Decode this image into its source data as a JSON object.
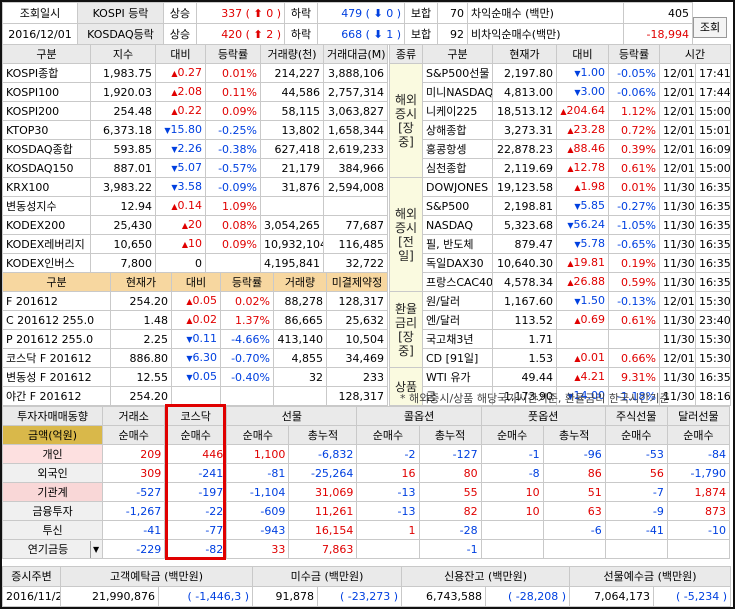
{
  "topbar": {
    "date_label": "조회일시",
    "date_value": "2016/12/01",
    "kospi_label": "KOSPI 등락",
    "kosdaq_label": "KOSDAQ등락",
    "up_label": "상승",
    "down_label": "하락",
    "flat_label": "보합",
    "kospi_up": "337",
    "kospi_uplimit": "0",
    "kospi_down": "479",
    "kospi_downlimit": "0",
    "kospi_flat": "70",
    "kosdaq_up": "420",
    "kosdaq_uplimit": "2",
    "kosdaq_down": "668",
    "kosdaq_downlimit": "1",
    "kosdaq_flat": "92",
    "arb_label": "차익순매수 (백만)",
    "arb_value": "405",
    "nonarb_label": "비차익순매수(백만)",
    "nonarb_value": "-18,994",
    "search_button": "조회"
  },
  "domestic": {
    "headers": [
      "구분",
      "지수",
      "대비",
      "등락률",
      "거래량(천)",
      "거래대금(M)"
    ],
    "rows": [
      [
        "KOSPI종합",
        "1,983.75",
        "up",
        "0.27",
        "0.01%",
        "214,227",
        "3,888,106"
      ],
      [
        "KOSPI100",
        "1,920.03",
        "up",
        "2.08",
        "0.11%",
        "44,586",
        "2,757,314"
      ],
      [
        "KOSPI200",
        "254.48",
        "up",
        "0.22",
        "0.09%",
        "58,115",
        "3,063,827"
      ],
      [
        "KTOP30",
        "6,373.18",
        "down",
        "15.80",
        "-0.25%",
        "13,802",
        "1,658,344"
      ],
      [
        "KOSDAQ종합",
        "593.85",
        "down",
        "2.26",
        "-0.38%",
        "627,418",
        "2,619,233"
      ],
      [
        "KOSDAQ150",
        "887.01",
        "down",
        "5.07",
        "-0.57%",
        "21,179",
        "384,966"
      ],
      [
        "KRX100",
        "3,983.22",
        "down",
        "3.58",
        "-0.09%",
        "31,876",
        "2,594,008"
      ],
      [
        "변동성지수",
        "12.94",
        "up",
        "0.14",
        "1.09%",
        "",
        ""
      ],
      [
        "KODEX200",
        "25,430",
        "up",
        "20",
        "0.08%",
        "3,054,265",
        "77,687"
      ],
      [
        "KODEX레버리지",
        "10,650",
        "up",
        "10",
        "0.09%",
        "10,932,104",
        "116,485"
      ],
      [
        "KODEX인버스",
        "7,800",
        "flat",
        "0",
        "",
        "4,195,841",
        "32,722"
      ]
    ]
  },
  "futures": {
    "headers": [
      "구분",
      "현재가",
      "대비",
      "등락률",
      "거래량",
      "미결제약정"
    ],
    "rows": [
      [
        "F 201612",
        "254.20",
        "up",
        "0.05",
        "0.02%",
        "88,278",
        "128,317"
      ],
      [
        "C 201612 255.0",
        "1.48",
        "up",
        "0.02",
        "1.37%",
        "86,665",
        "25,632"
      ],
      [
        "P 201612 255.0",
        "2.25",
        "down",
        "0.11",
        "-4.66%",
        "413,140",
        "10,504"
      ],
      [
        "코스닥 F 201612",
        "886.80",
        "down",
        "6.30",
        "-0.70%",
        "4,855",
        "34,469"
      ],
      [
        "변동성 F 201612",
        "12.55",
        "down",
        "0.05",
        "-0.40%",
        "32",
        "233"
      ],
      [
        "야간 F 201612",
        "254.20",
        "",
        "",
        "",
        "",
        "128,317"
      ]
    ]
  },
  "overseas": {
    "headers": [
      "종류",
      "구분",
      "현재가",
      "대비",
      "등락률",
      "시간"
    ],
    "groups": [
      {
        "label": "해외증시 [장중]",
        "rows": [
          [
            "S&P500선물",
            "2,197.80",
            "down",
            "1.00",
            "-0.05%",
            "12/01",
            "17:41"
          ],
          [
            "미니NASDAQ",
            "4,813.00",
            "down",
            "3.00",
            "-0.06%",
            "12/01",
            "17:44"
          ],
          [
            "니케이225",
            "18,513.12",
            "up",
            "204.64",
            "1.12%",
            "12/01",
            "15:00"
          ],
          [
            "상해종합",
            "3,273.31",
            "up",
            "23.28",
            "0.72%",
            "12/01",
            "15:01"
          ],
          [
            "홍콩항셍",
            "22,878.23",
            "up",
            "88.46",
            "0.39%",
            "12/01",
            "16:09"
          ],
          [
            "심천종합",
            "2,119.69",
            "up",
            "12.78",
            "0.61%",
            "12/01",
            "15:00"
          ]
        ]
      },
      {
        "label": "해외증시 [전일]",
        "rows": [
          [
            "DOWJONES",
            "19,123.58",
            "up",
            "1.98",
            "0.01%",
            "11/30",
            "16:35"
          ],
          [
            "S&P500",
            "2,198.81",
            "down",
            "5.85",
            "-0.27%",
            "11/30",
            "16:35"
          ],
          [
            "NASDAQ",
            "5,323.68",
            "down",
            "56.24",
            "-1.05%",
            "11/30",
            "16:35"
          ],
          [
            "필, 반도체",
            "879.47",
            "down",
            "5.78",
            "-0.65%",
            "11/30",
            "16:35"
          ],
          [
            "독일DAX30",
            "10,640.30",
            "up",
            "19.81",
            "0.19%",
            "11/30",
            "16:35"
          ],
          [
            "프랑스CAC40",
            "4,578.34",
            "up",
            "26.88",
            "0.59%",
            "11/30",
            "16:35"
          ]
        ]
      },
      {
        "label": "환율 금리 [장중]",
        "rows": [
          [
            "원/달러",
            "1,167.60",
            "down",
            "1.50",
            "-0.13%",
            "12/01",
            "15:30"
          ],
          [
            "엔/달러",
            "113.52",
            "up",
            "0.69",
            "0.61%",
            "11/30",
            "23:40"
          ],
          [
            "국고채3년",
            "1.71",
            "",
            "",
            "",
            "11/30",
            "15:30"
          ],
          [
            "CD [91일]",
            "1.53",
            "up",
            "0.01",
            "0.66%",
            "12/01",
            "15:30"
          ]
        ]
      },
      {
        "label": "상품",
        "rows": [
          [
            "WTI 유가",
            "49.44",
            "up",
            "4.21",
            "9.31%",
            "11/30",
            "16:35"
          ],
          [
            "금",
            "1,173.90",
            "down",
            "14.00",
            "-1.18%",
            "11/30",
            "18:16"
          ]
        ]
      }
    ],
    "note": "* 해외증시/상품 해당국가시간기준, 환율금리 한국시간기준"
  },
  "investors": {
    "title": "투자자매매동향",
    "unit_label": "금액(억원)",
    "col_groups": [
      "거래소",
      "코스닥",
      "선물",
      "콜옵션",
      "풋옵션",
      "주식선물",
      "달러선물"
    ],
    "sub_net": "순매수",
    "sub_cum": "총누적",
    "rows": [
      {
        "name": "개인",
        "vals": [
          "209",
          "446",
          "1,100",
          "-6,832",
          "-2",
          "-127",
          "-1",
          "-96",
          "-53",
          "-84"
        ]
      },
      {
        "name": "외국인",
        "vals": [
          "309",
          "-241",
          "-81",
          "-25,264",
          "16",
          "80",
          "-8",
          "86",
          "56",
          "-1,790"
        ]
      },
      {
        "name": "기관계",
        "vals": [
          "-527",
          "-197",
          "-1,104",
          "31,069",
          "-13",
          "55",
          "10",
          "51",
          "-7",
          "1,874"
        ]
      },
      {
        "name": "금융투자",
        "vals": [
          "-1,267",
          "-22",
          "-609",
          "11,261",
          "-13",
          "82",
          "10",
          "63",
          "-9",
          "873"
        ]
      },
      {
        "name": "투신",
        "vals": [
          "-41",
          "-77",
          "-943",
          "16,154",
          "1",
          "-28",
          "",
          "-6",
          "-41",
          "-10"
        ]
      },
      {
        "name": "연기금등",
        "vals": [
          "-229",
          "-82",
          "33",
          "7,863",
          "",
          "-1",
          "",
          "",
          "",
          ""
        ]
      }
    ]
  },
  "summary": {
    "date_label": "증시주변",
    "date_value": "2016/11/29",
    "deposit_label": "고객예탁금 (백만원)",
    "deposit_value": "21,990,876",
    "deposit_change": "( -1,446,3 )",
    "unpaid_label": "미수금 (백만원)",
    "unpaid_value": "91,878",
    "unpaid_change": "( -23,273 )",
    "credit_label": "신용잔고 (백만원)",
    "credit_value": "6,743,588",
    "credit_change": "( -28,208 )",
    "futdep_label": "선물예수금 (백만원)",
    "futdep_value": "7,064,173",
    "futdep_change": "( -5,234 )"
  },
  "colors": {
    "up": "#e00000",
    "down": "#0040e0",
    "highlight": "#e00000",
    "header_gold": "#d9b84a"
  }
}
